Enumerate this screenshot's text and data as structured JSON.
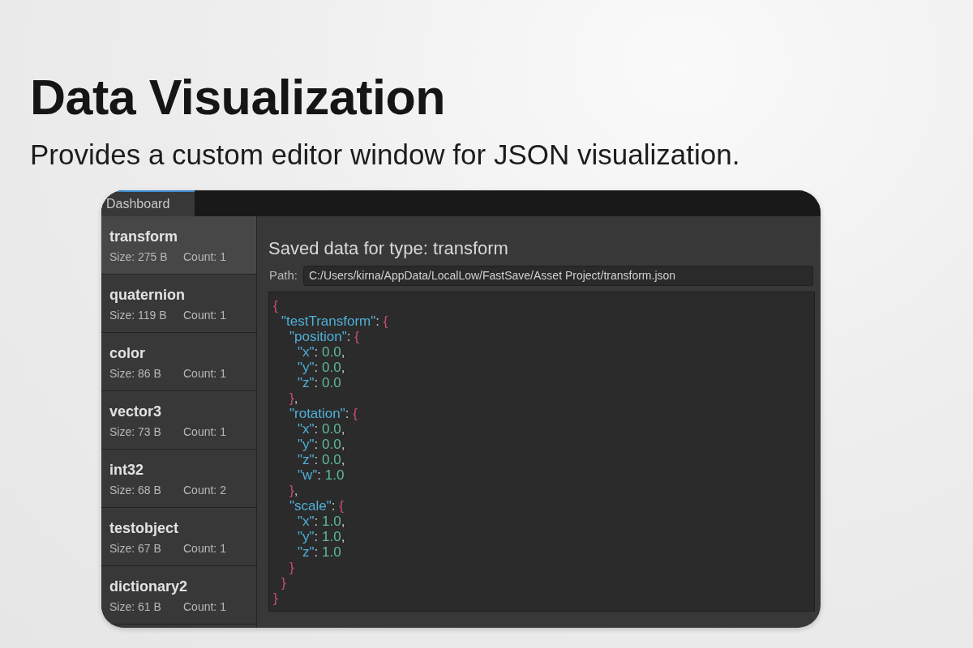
{
  "header": {
    "title": "Data Visualization",
    "subtitle": "Provides a custom editor window for JSON visualization."
  },
  "window": {
    "tabs": [
      {
        "label": "Dashboard",
        "selected": true
      }
    ],
    "sidebar": {
      "items": [
        {
          "name": "transform",
          "size": "Size: 275 B",
          "count": "Count: 1",
          "selected": true
        },
        {
          "name": "quaternion",
          "size": "Size: 119 B",
          "count": "Count: 1",
          "selected": false
        },
        {
          "name": "color",
          "size": "Size: 86 B",
          "count": "Count: 1",
          "selected": false
        },
        {
          "name": "vector3",
          "size": "Size: 73 B",
          "count": "Count: 1",
          "selected": false
        },
        {
          "name": "int32",
          "size": "Size: 68 B",
          "count": "Count: 2",
          "selected": false
        },
        {
          "name": "testobject",
          "size": "Size: 67 B",
          "count": "Count: 1",
          "selected": false
        },
        {
          "name": "dictionary2",
          "size": "Size: 61 B",
          "count": "Count: 1",
          "selected": false
        }
      ]
    },
    "detail": {
      "heading": "Saved data for type: transform",
      "path_label": "Path:",
      "path_value": "C:/Users/kirna/AppData/LocalLow/FastSave/Asset Project/transform.json",
      "json_view": {
        "open": "{",
        "close": "}",
        "children": [
          {
            "key": "\"testTransform\"",
            "sep": ":",
            "open": "{",
            "close": "}",
            "children": [
              {
                "key": "\"position\"",
                "sep": ":",
                "open": "{",
                "close": "}",
                "comma": ",",
                "children": [
                  {
                    "key": "\"x\"",
                    "sep": ":",
                    "value": "0.0",
                    "comma": ","
                  },
                  {
                    "key": "\"y\"",
                    "sep": ":",
                    "value": "0.0",
                    "comma": ","
                  },
                  {
                    "key": "\"z\"",
                    "sep": ":",
                    "value": "0.0"
                  }
                ]
              },
              {
                "key": "\"rotation\"",
                "sep": ":",
                "open": "{",
                "close": "}",
                "comma": ",",
                "children": [
                  {
                    "key": "\"x\"",
                    "sep": ":",
                    "value": "0.0",
                    "comma": ","
                  },
                  {
                    "key": "\"y\"",
                    "sep": ":",
                    "value": "0.0",
                    "comma": ","
                  },
                  {
                    "key": "\"z\"",
                    "sep": ":",
                    "value": "0.0",
                    "comma": ","
                  },
                  {
                    "key": "\"w\"",
                    "sep": ":",
                    "value": "1.0"
                  }
                ]
              },
              {
                "key": "\"scale\"",
                "sep": ":",
                "open": "{",
                "close": "}",
                "children": [
                  {
                    "key": "\"x\"",
                    "sep": ":",
                    "value": "1.0",
                    "comma": ","
                  },
                  {
                    "key": "\"y\"",
                    "sep": ":",
                    "value": "1.0",
                    "comma": ","
                  },
                  {
                    "key": "\"z\"",
                    "sep": ":",
                    "value": "1.0"
                  }
                ]
              }
            ]
          }
        ]
      }
    }
  }
}
